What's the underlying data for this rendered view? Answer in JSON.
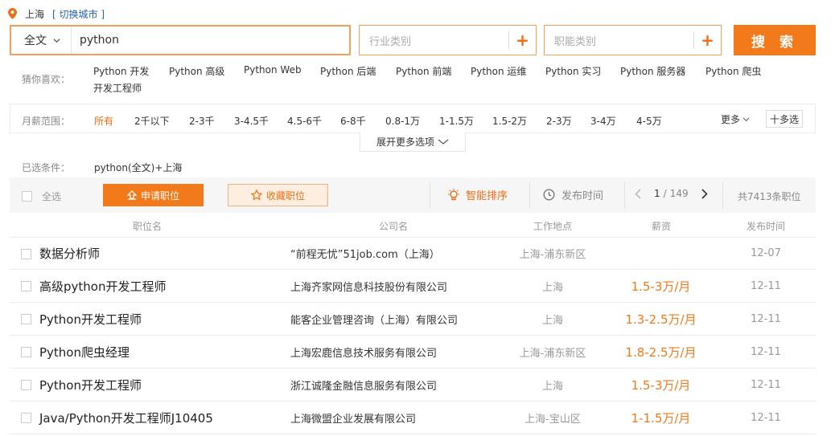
{
  "location": {
    "city": "上海",
    "switch_label": "[ 切换城市 ]"
  },
  "search": {
    "scope": "全文",
    "keyword": "python",
    "industry_placeholder": "行业类别",
    "function_placeholder": "职能类别",
    "plus": "+",
    "button": "搜 索"
  },
  "suggestions": {
    "label": "猜你喜欢：",
    "items": [
      "Python 开发",
      "Python 高级",
      "Python Web",
      "Python 后端",
      "Python 前端",
      "Python 运维",
      "Python 实习",
      "Python 服务器",
      "Python 爬虫",
      "开发工程师"
    ]
  },
  "salary_filter": {
    "label": "月薪范围：",
    "options": [
      "所有",
      "2千以下",
      "2-3千",
      "3-4.5千",
      "4.5-6千",
      "6-8千",
      "0.8-1万",
      "1-1.5万",
      "1.5-2万",
      "2-3万",
      "3-4万",
      "4-5万"
    ],
    "active_index": 0,
    "more": "更多",
    "multi_select": "十多选",
    "expand": "展开更多选项"
  },
  "selected": {
    "label": "已选条件：",
    "value": "python(全文)+上海"
  },
  "toolbar": {
    "select_all": "全选",
    "apply": "申请职位",
    "favorite": "收藏职位",
    "smart_sort": "智能排序",
    "publish_time": "发布时间",
    "page_current": "1",
    "page_sep": "/",
    "page_total": "149",
    "total": "共7413条职位"
  },
  "table": {
    "headers": {
      "title": "职位名",
      "company": "公司名",
      "location": "工作地点",
      "salary": "薪资",
      "date": "发布时间"
    },
    "rows": [
      {
        "title": "数据分析师",
        "company": "“前程无忧”51job.com（上海）",
        "location": "上海-浦东新区",
        "salary": "",
        "date": "12-07"
      },
      {
        "title": "高级python开发工程师",
        "company": "上海齐家网信息科技股份有限公司",
        "location": "上海",
        "salary": "1.5-3万/月",
        "date": "12-11"
      },
      {
        "title": "Python开发工程师",
        "company": "能客企业管理咨询（上海）有限公司",
        "location": "上海",
        "salary": "1.3-2.5万/月",
        "date": "12-11"
      },
      {
        "title": "Python爬虫经理",
        "company": "上海宏鹿信息技术服务有限公司",
        "location": "上海-浦东新区",
        "salary": "1.8-2.5万/月",
        "date": "12-11"
      },
      {
        "title": "Python开发工程师",
        "company": "浙江诚隆金融信息服务有限公司",
        "location": "上海",
        "salary": "1.5-3万/月",
        "date": "12-11"
      },
      {
        "title": "Java/Python开发工程师J10405",
        "company": "上海微盟企业发展有限公司",
        "location": "上海-宝山区",
        "salary": "1-1.5万/月",
        "date": "12-11"
      }
    ]
  },
  "colors": {
    "accent": "#f27a1a",
    "link": "#2563ad",
    "muted": "#999999"
  }
}
